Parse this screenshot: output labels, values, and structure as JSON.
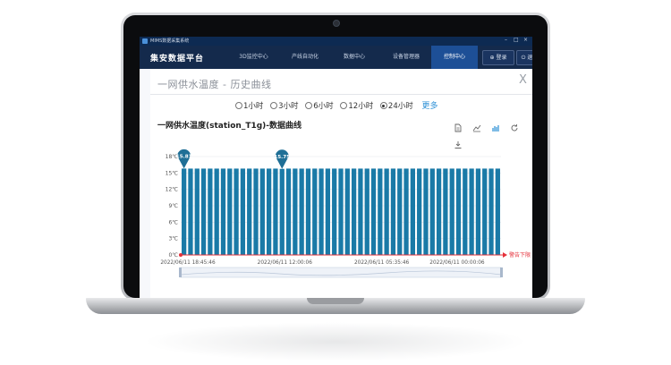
{
  "app": {
    "window_title": "MIMS数据采集系统",
    "brand": "集安数据平台"
  },
  "nav": {
    "items": [
      {
        "label": "3D监控中心"
      },
      {
        "label": "产线自动化"
      },
      {
        "label": "数据中心"
      },
      {
        "label": "设备管理器"
      },
      {
        "label": "控制中心",
        "active": true
      }
    ],
    "login_label": "登录",
    "extra_label": "退"
  },
  "dialog": {
    "title": "一网供水温度 - 历史曲线",
    "close_label": "X",
    "ranges": [
      {
        "label": "1小时",
        "selected": false
      },
      {
        "label": "3小时",
        "selected": false
      },
      {
        "label": "6小时",
        "selected": false
      },
      {
        "label": "12小时",
        "selected": false
      },
      {
        "label": "24小时",
        "selected": true
      }
    ],
    "more_label": "更多"
  },
  "toolbox": [
    "document-icon",
    "line-chart-icon",
    "bar-chart-icon",
    "refresh-icon",
    "download-icon"
  ],
  "colors": {
    "bar": "#1a7aa7",
    "pin": "#1f6f96",
    "threshold": "#e5303a",
    "nav_bg": "#142a4c",
    "nav_active": "#1d4f96"
  },
  "chart_data": {
    "type": "bar",
    "title": "一网供水温度(station_T1g)-数据曲线",
    "yticks": [
      "0℃",
      "3℃",
      "6℃",
      "9℃",
      "12℃",
      "15℃",
      "18℃"
    ],
    "ylim": [
      0,
      18
    ],
    "xticks": [
      "2022/06/11 18:45:46",
      "2022/06/11 12:00:06",
      "2022/06/11 05:35:46",
      "2022/06/11 00:00:06"
    ],
    "values": [
      15.81,
      15.8,
      15.8,
      15.8,
      15.8,
      15.8,
      15.8,
      15.8,
      15.8,
      15.8,
      15.8,
      15.8,
      15.8,
      15.8,
      15.8,
      15.75,
      15.8,
      15.8,
      15.8,
      15.8,
      15.8,
      15.8,
      15.8,
      15.8,
      15.8,
      15.8,
      15.8,
      15.8,
      15.8,
      15.8,
      15.8,
      15.8,
      15.8,
      15.8,
      15.8,
      15.8,
      15.8,
      15.8,
      15.8,
      15.8,
      15.8,
      15.8,
      15.8,
      15.8,
      15.8,
      15.8,
      15.8,
      15.8,
      15.8
    ],
    "markers": [
      {
        "label": "15.81",
        "index": 0
      },
      {
        "label": "15.75",
        "index": 15
      }
    ],
    "threshold": {
      "label": "警告下限 0",
      "value": 0
    },
    "grid": true
  }
}
